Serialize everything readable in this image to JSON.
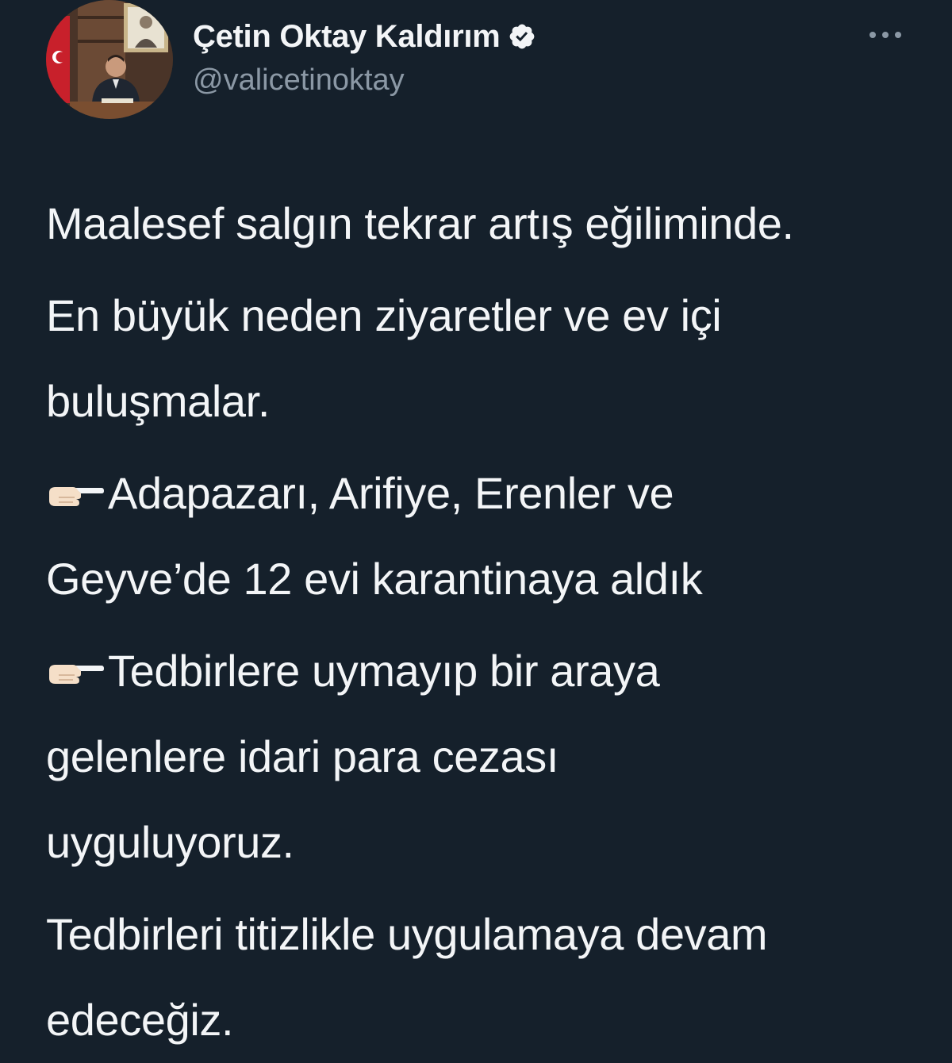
{
  "author": {
    "display_name": "Çetin Oktay Kaldırım",
    "handle": "@valicetinoktay",
    "verified": true
  },
  "icons": {
    "verified": "verified-badge-icon",
    "more": "more-options-icon",
    "pointing": "backhand-index-pointing-right-emoji"
  },
  "colors": {
    "background": "#15202b",
    "text": "#f3f5f7",
    "muted": "#8b98a5"
  },
  "tweet": {
    "p1": "Maalesef salgın tekrar artış eğiliminde.",
    "p2_l1": "En büyük neden ziyaretler ve ev içi",
    "p2_l2": "buluşmalar.",
    "p3_l1": "Adapazarı, Arifiye, Erenler ve",
    "p3_l2": "Geyve’de 12 evi karantinaya aldık",
    "p4_l1": "Tedbirlere uymayıp bir araya",
    "p4_l2": "gelenlere idari para cezası",
    "p4_l3": "uyguluyoruz.",
    "p5_l1": "Tedbirleri titizlikle uygulamaya devam",
    "p5_l2": "edeceğiz."
  }
}
